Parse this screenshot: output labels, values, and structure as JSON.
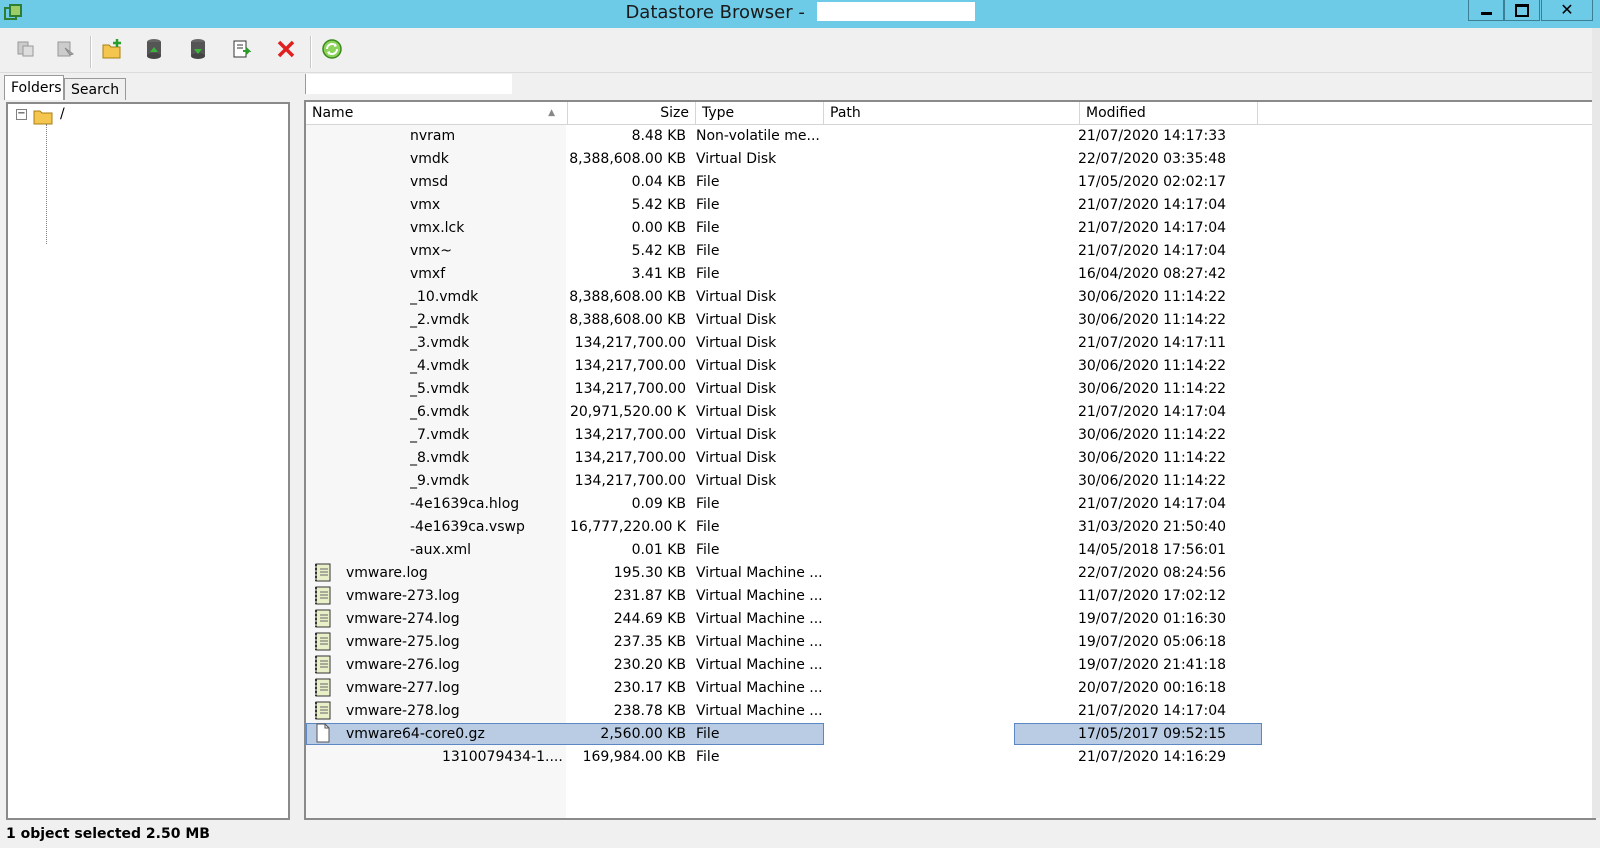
{
  "window": {
    "title": "Datastore Browser - "
  },
  "toolbar": {
    "buttons": [
      {
        "name": "copy-icon"
      },
      {
        "name": "paste-icon"
      },
      {
        "name": "new-folder-icon"
      },
      {
        "name": "upload-icon"
      },
      {
        "name": "download-icon"
      },
      {
        "name": "register-vm-icon"
      },
      {
        "name": "delete-icon"
      },
      {
        "name": "refresh-icon"
      }
    ]
  },
  "tabs": {
    "folders": "Folders",
    "search": "Search"
  },
  "tree": {
    "root_label": "/"
  },
  "columns": {
    "name": "Name",
    "size": "Size",
    "type": "Type",
    "path": "Path",
    "modified": "Modified"
  },
  "files": [
    {
      "name": "nvram",
      "size": "8.48 KB",
      "type": "Non-volatile me...",
      "modified": "21/07/2020 14:17:33",
      "icon": "none"
    },
    {
      "name": "vmdk",
      "size": "8,388,608.00 KB",
      "type": "Virtual Disk",
      "modified": "22/07/2020 03:35:48",
      "icon": "none"
    },
    {
      "name": "vmsd",
      "size": "0.04 KB",
      "type": "File",
      "modified": "17/05/2020 02:02:17",
      "icon": "none"
    },
    {
      "name": "vmx",
      "size": "5.42 KB",
      "type": "File",
      "modified": "21/07/2020 14:17:04",
      "icon": "none"
    },
    {
      "name": "vmx.lck",
      "size": "0.00 KB",
      "type": "File",
      "modified": "21/07/2020 14:17:04",
      "icon": "none"
    },
    {
      "name": "vmx~",
      "size": "5.42 KB",
      "type": "File",
      "modified": "21/07/2020 14:17:04",
      "icon": "none"
    },
    {
      "name": "vmxf",
      "size": "3.41 KB",
      "type": "File",
      "modified": "16/04/2020 08:27:42",
      "icon": "none"
    },
    {
      "name": "_10.vmdk",
      "size": "8,388,608.00 KB",
      "type": "Virtual Disk",
      "modified": "30/06/2020 11:14:22",
      "icon": "none"
    },
    {
      "name": "_2.vmdk",
      "size": "8,388,608.00 KB",
      "type": "Virtual Disk",
      "modified": "30/06/2020 11:14:22",
      "icon": "none"
    },
    {
      "name": "_3.vmdk",
      "size": "134,217,700.00",
      "type": "Virtual Disk",
      "modified": "21/07/2020 14:17:11",
      "icon": "none"
    },
    {
      "name": "_4.vmdk",
      "size": "134,217,700.00",
      "type": "Virtual Disk",
      "modified": "30/06/2020 11:14:22",
      "icon": "none"
    },
    {
      "name": "_5.vmdk",
      "size": "134,217,700.00",
      "type": "Virtual Disk",
      "modified": "30/06/2020 11:14:22",
      "icon": "none"
    },
    {
      "name": "_6.vmdk",
      "size": "20,971,520.00 K",
      "type": "Virtual Disk",
      "modified": "21/07/2020 14:17:04",
      "icon": "none"
    },
    {
      "name": "_7.vmdk",
      "size": "134,217,700.00",
      "type": "Virtual Disk",
      "modified": "30/06/2020 11:14:22",
      "icon": "none"
    },
    {
      "name": "_8.vmdk",
      "size": "134,217,700.00",
      "type": "Virtual Disk",
      "modified": "30/06/2020 11:14:22",
      "icon": "none"
    },
    {
      "name": "_9.vmdk",
      "size": "134,217,700.00",
      "type": "Virtual Disk",
      "modified": "30/06/2020 11:14:22",
      "icon": "none"
    },
    {
      "name": "-4e1639ca.hlog",
      "size": "0.09 KB",
      "type": "File",
      "modified": "21/07/2020 14:17:04",
      "icon": "none"
    },
    {
      "name": "-4e1639ca.vswp",
      "size": "16,777,220.00 K",
      "type": "File",
      "modified": "31/03/2020 21:50:40",
      "icon": "none"
    },
    {
      "name": "-aux.xml",
      "size": "0.01 KB",
      "type": "File",
      "modified": "14/05/2018 17:56:01",
      "icon": "none"
    },
    {
      "name": "vmware.log",
      "size": "195.30 KB",
      "type": "Virtual Machine ...",
      "modified": "22/07/2020 08:24:56",
      "icon": "log"
    },
    {
      "name": "vmware-273.log",
      "size": "231.87 KB",
      "type": "Virtual Machine ...",
      "modified": "11/07/2020 17:02:12",
      "icon": "log"
    },
    {
      "name": "vmware-274.log",
      "size": "244.69 KB",
      "type": "Virtual Machine ...",
      "modified": "19/07/2020 01:16:30",
      "icon": "log"
    },
    {
      "name": "vmware-275.log",
      "size": "237.35 KB",
      "type": "Virtual Machine ...",
      "modified": "19/07/2020 05:06:18",
      "icon": "log"
    },
    {
      "name": "vmware-276.log",
      "size": "230.20 KB",
      "type": "Virtual Machine ...",
      "modified": "19/07/2020 21:41:18",
      "icon": "log"
    },
    {
      "name": "vmware-277.log",
      "size": "230.17 KB",
      "type": "Virtual Machine ...",
      "modified": "20/07/2020 00:16:18",
      "icon": "log"
    },
    {
      "name": "vmware-278.log",
      "size": "238.78 KB",
      "type": "Virtual Machine ...",
      "modified": "21/07/2020 14:17:04",
      "icon": "log"
    },
    {
      "name": "vmware64-core0.gz",
      "size": "2,560.00 KB",
      "type": "File",
      "modified": "17/05/2017 09:52:15",
      "icon": "file",
      "selected": true
    },
    {
      "name": "1310079434-1....",
      "size": "169,984.00 KB",
      "type": "File",
      "modified": "21/07/2020 14:16:29",
      "icon": "none"
    }
  ],
  "status": {
    "text": "1 object selected 2.50 MB"
  },
  "colors": {
    "titlebar": "#6dcbe8",
    "selection": "#b9cce3",
    "selection_border": "#5b87c2"
  }
}
